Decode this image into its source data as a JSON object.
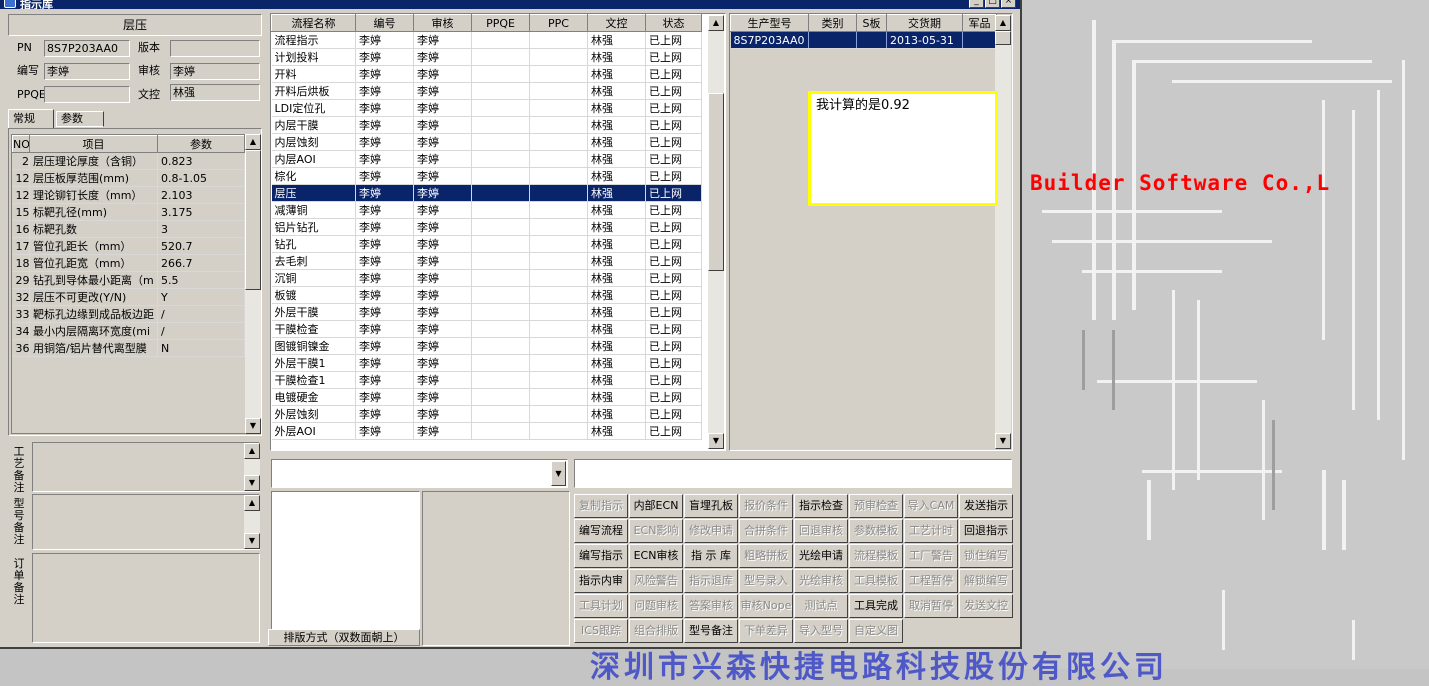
{
  "window": {
    "title": "指示库"
  },
  "left": {
    "section_title": "层压",
    "pn_label": "PN",
    "pn_value": "8S7P203AA0",
    "version_label": "版本",
    "version_value": "",
    "editor_label": "编写",
    "editor_value": "李婷",
    "reviewer_label": "审核",
    "reviewer_value": "李婷",
    "ppqe_label": "PPQE",
    "ppqe_value": "",
    "doc_label": "文控",
    "doc_value": "林强",
    "tabs": [
      {
        "label": "常规"
      },
      {
        "label": "参数"
      }
    ],
    "param_headers": {
      "no": "NO",
      "item": "项目",
      "param": "参数"
    },
    "params": [
      {
        "no": "2",
        "item": "层压理论厚度（含铜）",
        "value": "0.823"
      },
      {
        "no": "12",
        "item": "层压板厚范围(mm)",
        "value": "0.8-1.05"
      },
      {
        "no": "12",
        "item": "理论铆钉长度（mm）",
        "value": "2.103"
      },
      {
        "no": "15",
        "item": "标靶孔径(mm)",
        "value": "3.175"
      },
      {
        "no": "16",
        "item": "标靶孔数",
        "value": "3"
      },
      {
        "no": "17",
        "item": "管位孔距长（mm）",
        "value": "520.7"
      },
      {
        "no": "18",
        "item": "管位孔距宽（mm）",
        "value": "266.7"
      },
      {
        "no": "29",
        "item": "钻孔到导体最小距离（m",
        "value": "5.5"
      },
      {
        "no": "32",
        "item": "层压不可更改(Y/N)",
        "value": "Y"
      },
      {
        "no": "33",
        "item": "靶标孔边缘到成品板边距",
        "value": "/"
      },
      {
        "no": "34",
        "item": "最小内层隔离环宽度(mi",
        "value": "/"
      },
      {
        "no": "36",
        "item": "用铜箔/铝片替代离型膜",
        "value": "N"
      }
    ],
    "notes": [
      {
        "label": "工艺备注",
        "value": ""
      },
      {
        "label": "型号备注",
        "value": ""
      },
      {
        "label": "订单备注",
        "value": ""
      }
    ]
  },
  "process": {
    "headers": [
      "流程名称",
      "编号",
      "审核",
      "PPQE",
      "PPC",
      "文控",
      "状态"
    ],
    "selected_index": 9,
    "rows": [
      [
        "流程指示",
        "李婷",
        "李婷",
        "",
        "",
        "林强",
        "已上网"
      ],
      [
        "计划投料",
        "李婷",
        "李婷",
        "",
        "",
        "林强",
        "已上网"
      ],
      [
        "开料",
        "李婷",
        "李婷",
        "",
        "",
        "林强",
        "已上网"
      ],
      [
        "开料后烘板",
        "李婷",
        "李婷",
        "",
        "",
        "林强",
        "已上网"
      ],
      [
        "LDI定位孔",
        "李婷",
        "李婷",
        "",
        "",
        "林强",
        "已上网"
      ],
      [
        "内层干膜",
        "李婷",
        "李婷",
        "",
        "",
        "林强",
        "已上网"
      ],
      [
        "内层蚀刻",
        "李婷",
        "李婷",
        "",
        "",
        "林强",
        "已上网"
      ],
      [
        "内层AOI",
        "李婷",
        "李婷",
        "",
        "",
        "林强",
        "已上网"
      ],
      [
        "棕化",
        "李婷",
        "李婷",
        "",
        "",
        "林强",
        "已上网"
      ],
      [
        "层压",
        "李婷",
        "李婷",
        "",
        "",
        "林强",
        "已上网"
      ],
      [
        "减薄铜",
        "李婷",
        "李婷",
        "",
        "",
        "林强",
        "已上网"
      ],
      [
        "铝片钻孔",
        "李婷",
        "李婷",
        "",
        "",
        "林强",
        "已上网"
      ],
      [
        "钻孔",
        "李婷",
        "李婷",
        "",
        "",
        "林强",
        "已上网"
      ],
      [
        "去毛刺",
        "李婷",
        "李婷",
        "",
        "",
        "林强",
        "已上网"
      ],
      [
        "沉铜",
        "李婷",
        "李婷",
        "",
        "",
        "林强",
        "已上网"
      ],
      [
        "板镀",
        "李婷",
        "李婷",
        "",
        "",
        "林强",
        "已上网"
      ],
      [
        "外层干膜",
        "李婷",
        "李婷",
        "",
        "",
        "林强",
        "已上网"
      ],
      [
        "干膜检查",
        "李婷",
        "李婷",
        "",
        "",
        "林强",
        "已上网"
      ],
      [
        "图镀铜镍金",
        "李婷",
        "李婷",
        "",
        "",
        "林强",
        "已上网"
      ],
      [
        "外层干膜1",
        "李婷",
        "李婷",
        "",
        "",
        "林强",
        "已上网"
      ],
      [
        "干膜检查1",
        "李婷",
        "李婷",
        "",
        "",
        "林强",
        "已上网"
      ],
      [
        "电镀硬金",
        "李婷",
        "李婷",
        "",
        "",
        "林强",
        "已上网"
      ],
      [
        "外层蚀刻",
        "李婷",
        "李婷",
        "",
        "",
        "林强",
        "已上网"
      ],
      [
        "外层AOI",
        "李婷",
        "李婷",
        "",
        "",
        "林强",
        "已上网"
      ]
    ]
  },
  "production": {
    "headers": [
      "生产型号",
      "类别",
      "S板",
      "交货期",
      "军品"
    ],
    "rows": [
      [
        "8S7P203AA0",
        "",
        "",
        "2013-05-31",
        ""
      ]
    ]
  },
  "note_popup": {
    "text": "我计算的是0.92"
  },
  "bottom": {
    "combo1_value": "",
    "combo2_value": "",
    "sort_label": "排版方式（双数面朝上）"
  },
  "buttons": [
    [
      {
        "label": "复制指示",
        "enabled": false
      },
      {
        "label": "内部ECN",
        "enabled": true
      },
      {
        "label": "盲埋孔板",
        "enabled": true
      },
      {
        "label": "报价条件",
        "enabled": false
      },
      {
        "label": "指示检查",
        "enabled": true
      },
      {
        "label": "预审检查",
        "enabled": false
      },
      {
        "label": "导入CAM",
        "enabled": false
      },
      {
        "label": "发送指示",
        "enabled": true
      }
    ],
    [
      {
        "label": "编写流程",
        "enabled": true
      },
      {
        "label": "ECN影响",
        "enabled": false
      },
      {
        "label": "修改申请",
        "enabled": false
      },
      {
        "label": "合拼条件",
        "enabled": false
      },
      {
        "label": "回退审核",
        "enabled": false
      },
      {
        "label": "参数模板",
        "enabled": false
      },
      {
        "label": "工艺计时",
        "enabled": false
      },
      {
        "label": "回退指示",
        "enabled": true
      }
    ],
    [
      {
        "label": "编写指示",
        "enabled": true
      },
      {
        "label": "ECN审核",
        "enabled": true
      },
      {
        "label": "指 示 库",
        "enabled": true
      },
      {
        "label": "粗略拼板",
        "enabled": false
      },
      {
        "label": "光绘申请",
        "enabled": true
      },
      {
        "label": "流程模板",
        "enabled": false
      },
      {
        "label": "工厂警告",
        "enabled": false
      },
      {
        "label": "锁住编写",
        "enabled": false
      }
    ],
    [
      {
        "label": "指示内审",
        "enabled": true
      },
      {
        "label": "风险警告",
        "enabled": false
      },
      {
        "label": "指示退库",
        "enabled": false
      },
      {
        "label": "型号录入",
        "enabled": false
      },
      {
        "label": "光绘审核",
        "enabled": false
      },
      {
        "label": "工具模板",
        "enabled": false
      },
      {
        "label": "工程暂停",
        "enabled": false
      },
      {
        "label": "解锁编写",
        "enabled": false
      }
    ],
    [
      {
        "label": "工具计划",
        "enabled": false
      },
      {
        "label": "问题审核",
        "enabled": false
      },
      {
        "label": "答案审核",
        "enabled": false
      },
      {
        "label": "审核Nope",
        "enabled": false
      },
      {
        "label": "测试点",
        "enabled": false
      },
      {
        "label": "工具完成",
        "enabled": true
      },
      {
        "label": "取消暂停",
        "enabled": false
      },
      {
        "label": "发送文控",
        "enabled": false
      }
    ],
    [
      {
        "label": "ICS跟踪",
        "enabled": false
      },
      {
        "label": "组合排版",
        "enabled": false
      },
      {
        "label": "型号备注",
        "enabled": true
      },
      {
        "label": "下单差异",
        "enabled": false
      },
      {
        "label": "导入型号",
        "enabled": false
      },
      {
        "label": "自定义图",
        "enabled": false
      }
    ]
  ],
  "desktop": {
    "brand_text": "Builder Software Co.,L",
    "brand_color": "#ff0000",
    "company_text": "深圳市兴森快捷电路科技股份有限公司",
    "company_color": "#3a47c8"
  }
}
